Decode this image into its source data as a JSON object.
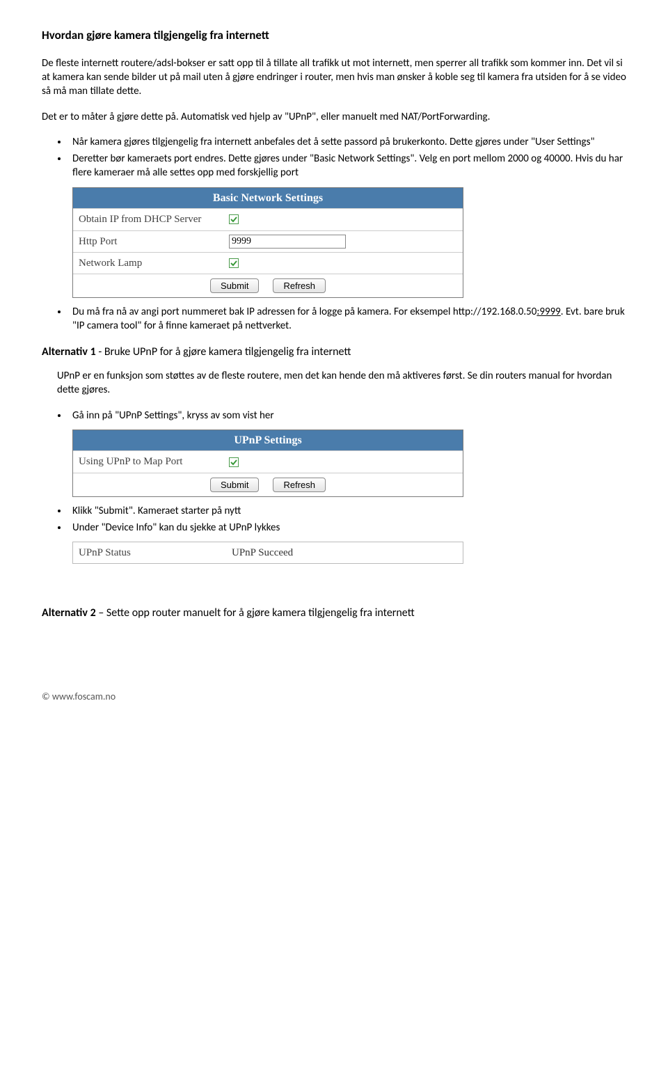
{
  "title": "Hvordan gjøre kamera tilgjengelig fra internett",
  "para1": "De fleste internett routere/adsl-bokser er satt opp til å tillate all trafikk ut mot internett, men sperrer all trafikk som kommer inn. Det vil si at kamera kan sende bilder ut på mail uten å gjøre endringer i router, men hvis man ønsker å koble seg til kamera fra utsiden for å se video så må man tillate dette.",
  "para2": "Det er to måter å gjøre dette på. Automatisk ved hjelp av \"UPnP\", eller manuelt med NAT/PortForwarding.",
  "bullets1": {
    "b1": "Når kamera gjøres tilgjengelig fra internett anbefales det å sette passord på brukerkonto. Dette gjøres under \"User Settings\"",
    "b2": "Deretter bør kameraets port endres. Dette gjøres under \"Basic Network Settings\". Velg en port mellom 2000 og 40000. Hvis du har flere kameraer må alle settes opp med forskjellig port"
  },
  "panel1": {
    "header": "Basic Network Settings",
    "rows": {
      "dhcp_label": "Obtain IP from DHCP Server",
      "http_label": "Http Port",
      "http_value": "9999",
      "lamp_label": "Network Lamp"
    },
    "submit": "Submit",
    "refresh": "Refresh"
  },
  "bullets2": {
    "b1a": "Du må fra nå av angi port nummeret bak IP adressen for å logge på kamera. For eksempel http://192.168.0.50",
    "b1port": ":9999",
    "b1b": ". Evt. bare bruk \"IP camera tool\" for å finne kameraet på nettverket."
  },
  "alt1": {
    "label": "Alternativ 1",
    "rest": " - Bruke UPnP for å gjøre kamera tilgjengelig fra internett",
    "para": "UPnP er en funksjon som støttes av de fleste routere, men det kan hende den må aktiveres først. Se din routers manual for hvordan dette gjøres.",
    "bullet1": "Gå inn på \"UPnP Settings\", kryss av som vist her"
  },
  "panel2": {
    "header": "UPnP Settings",
    "row_label": "Using UPnP to Map Port",
    "submit": "Submit",
    "refresh": "Refresh"
  },
  "bullets3": {
    "b1": "Klikk \"Submit\". Kameraet starter på nytt",
    "b2": "Under \"Device Info\" kan du sjekke at UPnP lykkes"
  },
  "panel3": {
    "label": "UPnP Status",
    "value": "UPnP Succeed"
  },
  "alt2": {
    "label": "Alternativ 2",
    "rest": " – Sette opp router manuelt for å gjøre kamera tilgjengelig fra internett"
  },
  "footer": "© www.foscam.no"
}
